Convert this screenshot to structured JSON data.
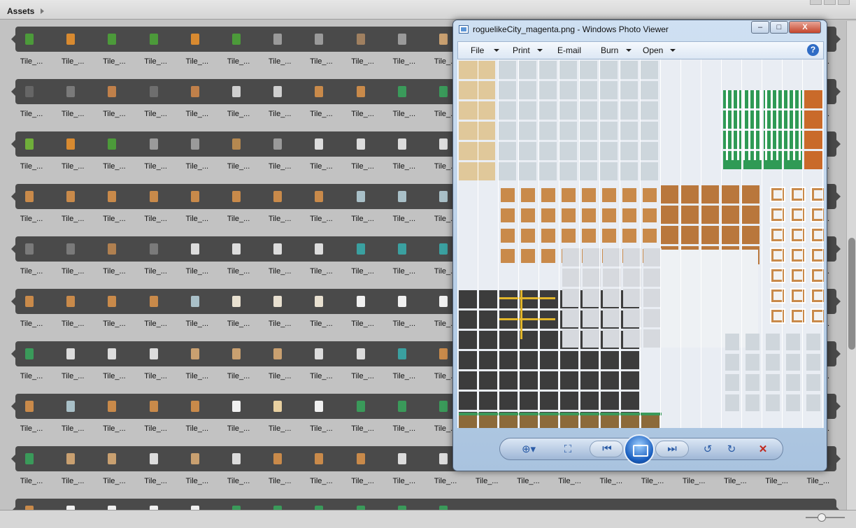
{
  "assets": {
    "title": "Assets"
  },
  "tile_label": "Tile_...",
  "strip_colors": [
    [
      "#4c9a3a",
      "#d88a30",
      "#4c9a3a",
      "#4c9a3a",
      "#d88a30",
      "#4c9a3a",
      "#9a9a9a",
      "#9a9a9a",
      "#a08060",
      "#9a9a9a",
      "#c9a070"
    ],
    [
      "#666666",
      "#7a7a7a",
      "#c0804a",
      "#6e6e6e",
      "#c0804a",
      "#cfcfcf",
      "#cfcfcf",
      "#c98a4a",
      "#c98a4a",
      "#3a9a5a",
      "#3a9a5a"
    ],
    [
      "#6fae3a",
      "#d88a30",
      "#4c9a3a",
      "#9a9a9a",
      "#9a9a9a",
      "#b58850",
      "#9a9a9a",
      "#dcdcdc",
      "#dcdcdc",
      "#dcdcdc",
      "#dcdcdc"
    ],
    [
      "#c98a4a",
      "#c98a4a",
      "#c98a4a",
      "#c98a4a",
      "#c98a4a",
      "#c98a4a",
      "#c98a4a",
      "#c98a4a",
      "#a9c0c8",
      "#a9c0c8",
      "#a9c0c8"
    ],
    [
      "#7a7a7a",
      "#7a7a7a",
      "#b08050",
      "#7a7a7a",
      "#dcdcdc",
      "#dcdcdc",
      "#dcdcdc",
      "#dcdcdc",
      "#3aa0a0",
      "#3aa0a0",
      "#3aa0a0"
    ],
    [
      "#c98a4a",
      "#c98a4a",
      "#c98a4a",
      "#c98a4a",
      "#a9c0c8",
      "#e8e0d0",
      "#e8e0d0",
      "#e8e0d0",
      "#f0f0f0",
      "#f0f0f0",
      "#f0f0f0"
    ],
    [
      "#3a9a5a",
      "#dcdcdc",
      "#dcdcdc",
      "#dcdcdc",
      "#c9a070",
      "#c9a070",
      "#c9a070",
      "#dcdcdc",
      "#dcdcdc",
      "#3aa0a0",
      "#c98a4a"
    ],
    [
      "#c98a4a",
      "#a9c0c8",
      "#c98a4a",
      "#c98a4a",
      "#c98a4a",
      "#f0f0f0",
      "#e8d0a0",
      "#f0f0f0",
      "#3a9a5a",
      "#3a9a5a",
      "#3a9a5a"
    ],
    [
      "#3a9a5a",
      "#c9a070",
      "#c9a070",
      "#dcdcdc",
      "#c9a070",
      "#dcdcdc",
      "#c98a4a",
      "#c98a4a",
      "#c98a4a",
      "#dcdcdc",
      "#dcdcdc"
    ],
    [
      "#c98a4a",
      "#f0f0f0",
      "#f0f0f0",
      "#f0f0f0",
      "#f0f0f0",
      "#3a9a5a",
      "#3a9a5a",
      "#3a9a5a",
      "#3a9a5a",
      "#3a9a5a",
      "#3a9a5a"
    ]
  ],
  "photo_viewer": {
    "title": "roguelikeCity_magenta.png - Windows Photo Viewer",
    "window_buttons": {
      "minimize": "–",
      "maximize": "□",
      "close": "X"
    },
    "menu": [
      {
        "label": "File",
        "has_dropdown": true
      },
      {
        "label": "Print",
        "has_dropdown": true
      },
      {
        "label": "E-mail",
        "has_dropdown": false
      },
      {
        "label": "Burn",
        "has_dropdown": true
      },
      {
        "label": "Open",
        "has_dropdown": true
      }
    ],
    "help": "?",
    "controls": {
      "zoom": "⊕▾",
      "actual_size": "⛶",
      "previous": "⏮",
      "next": "⏭",
      "rotate_ccw": "↺",
      "rotate_cw": "↻",
      "delete": "✕"
    }
  },
  "colors": {
    "strip": "#4a4a4a",
    "road": "#3c3c3c",
    "road_line": "#e2b62a",
    "wood": "#c98a4a",
    "grass": "#3a9a5a",
    "glass": "#cdd6dc",
    "awning_green": "#2f9a55"
  }
}
